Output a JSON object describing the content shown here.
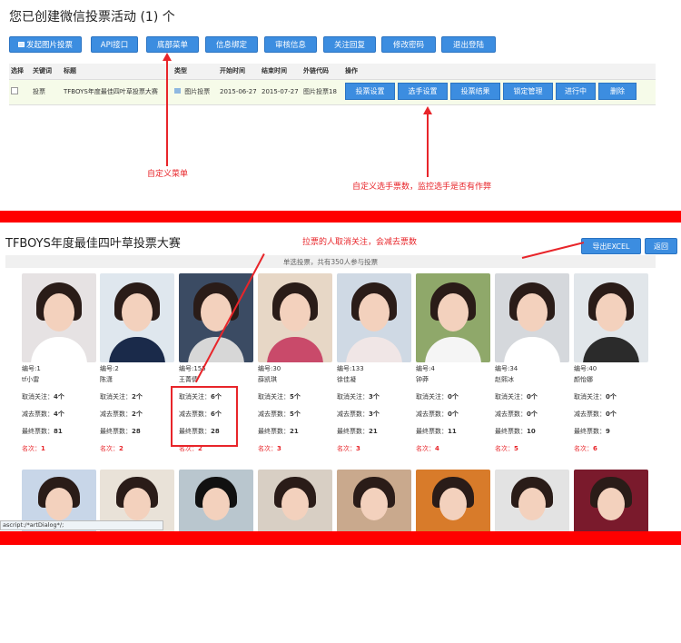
{
  "top": {
    "title": "您已创建微信投票活动 (1) 个",
    "toolbar": [
      "发起图片投票",
      "API接口",
      "底部菜单",
      "信息绑定",
      "审核信息",
      "关注回复",
      "修改密码",
      "退出登陆"
    ],
    "table": {
      "headers": [
        "选择",
        "关键词",
        "标题",
        "类型",
        "开始时间",
        "结束时间",
        "外链代码",
        "操作"
      ],
      "row": {
        "keyword": "投票",
        "title": "TFBOYS年度最佳四叶草投票大赛",
        "type": "图片投票",
        "start": "2015-06-27",
        "end": "2015-07-27",
        "link": "图片投票18"
      },
      "ops": [
        "投票设置",
        "选手设置",
        "投票结果",
        "锁定管理",
        "进行中",
        "删除"
      ]
    },
    "annotations": {
      "menu": "自定义菜单",
      "voters": "自定义选手票数，监控选手是否有作弊"
    }
  },
  "bottom": {
    "title": "TFBOYS年度最佳四叶草投票大赛",
    "subheader": "单选投票，共有350人参与投票",
    "export_label": "导出EXCEL",
    "back_label": "返回",
    "annotation": "拉票的人取消关注，会减去票数",
    "status_text": "ascript:/*artDialog*/;",
    "labels": {
      "unfollow": "取消关注：",
      "deduct": "减去票数：",
      "final": "最终票数：",
      "rank": "名次："
    },
    "contestants": [
      {
        "num": "编号:1",
        "name": "tf小雷",
        "unfollow": "4个",
        "deduct": "4个",
        "final": "81",
        "rank": "1"
      },
      {
        "num": "编号:2",
        "name": "陈潇",
        "unfollow": "2个",
        "deduct": "2个",
        "final": "28",
        "rank": "2"
      },
      {
        "num": "编号:155",
        "name": "王菁倩",
        "unfollow": "6个",
        "deduct": "6个",
        "final": "28",
        "rank": "2"
      },
      {
        "num": "编号:30",
        "name": "薛凯琪",
        "unfollow": "5个",
        "deduct": "5个",
        "final": "21",
        "rank": "3"
      },
      {
        "num": "编号:133",
        "name": "徐佳凝",
        "unfollow": "3个",
        "deduct": "3个",
        "final": "21",
        "rank": "3"
      },
      {
        "num": "编号:4",
        "name": "钟莽",
        "unfollow": "0个",
        "deduct": "0个",
        "final": "11",
        "rank": "4"
      },
      {
        "num": "编号:34",
        "name": "赵熙冰",
        "unfollow": "0个",
        "deduct": "0个",
        "final": "10",
        "rank": "5"
      },
      {
        "num": "编号:40",
        "name": "颜怡娜",
        "unfollow": "0个",
        "deduct": "0个",
        "final": "9",
        "rank": "6"
      }
    ]
  },
  "colors": {
    "accent": "#3c8de0",
    "annotation": "#e8252a",
    "band": "#ff0000"
  }
}
